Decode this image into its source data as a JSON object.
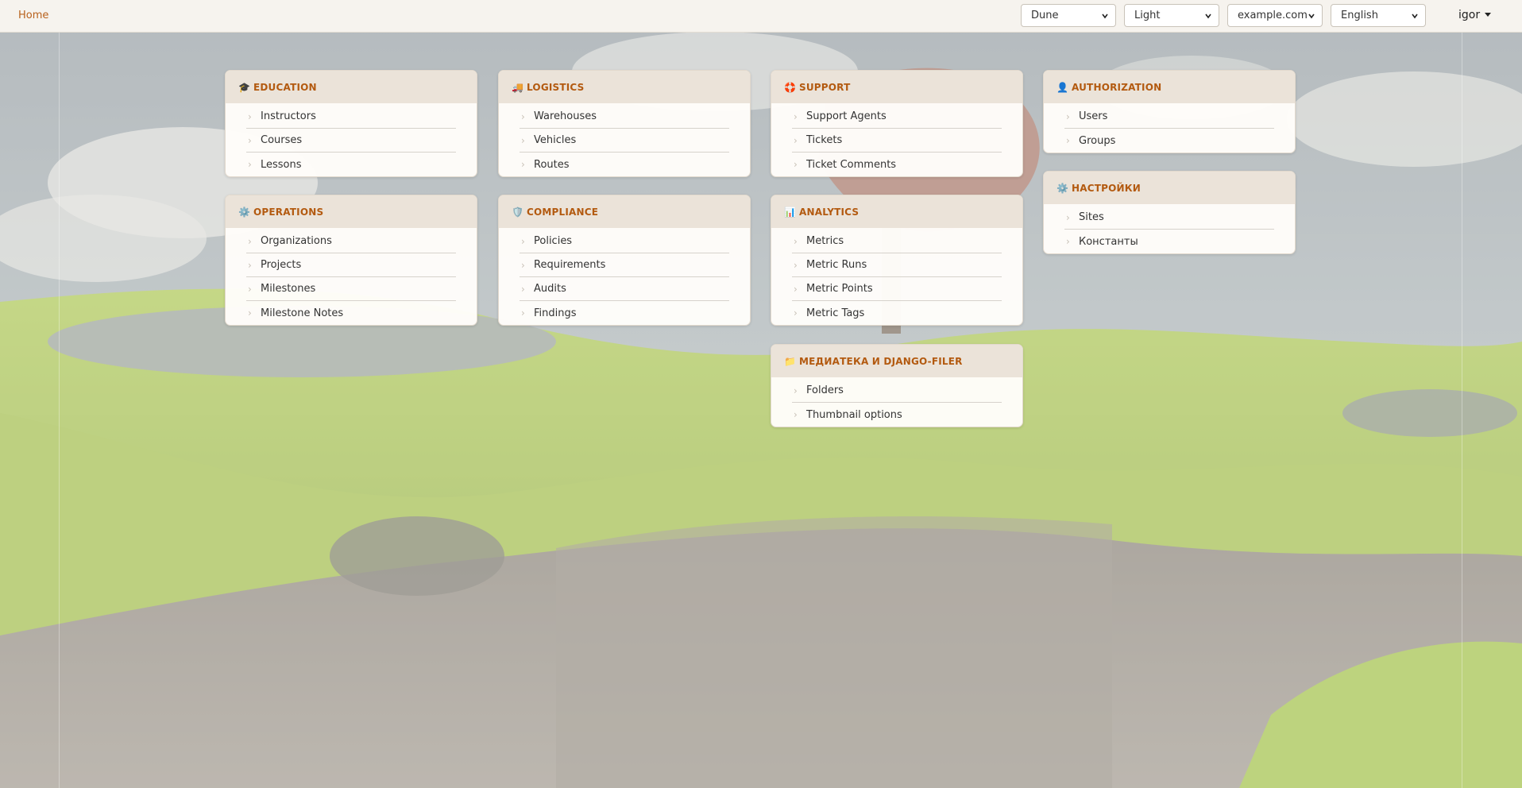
{
  "header": {
    "home_label": "Home",
    "selects": [
      {
        "value": "Dune"
      },
      {
        "value": "Light"
      },
      {
        "value": "example.com"
      },
      {
        "value": "English"
      }
    ],
    "user_label": "igor"
  },
  "modules": {
    "education": {
      "title": "EDUCATION",
      "icon": "graduation-cap-icon",
      "items": [
        {
          "label": "Instructors"
        },
        {
          "label": "Courses"
        },
        {
          "label": "Lessons"
        }
      ]
    },
    "logistics": {
      "title": "LOGISTICS",
      "icon": "truck-icon",
      "items": [
        {
          "label": "Warehouses"
        },
        {
          "label": "Vehicles"
        },
        {
          "label": "Routes"
        }
      ]
    },
    "support": {
      "title": "SUPPORT",
      "icon": "lifebuoy-icon",
      "items": [
        {
          "label": "Support Agents"
        },
        {
          "label": "Tickets"
        },
        {
          "label": "Ticket Comments"
        }
      ]
    },
    "authorization": {
      "title": "AUTHORIZATION",
      "icon": "user-icon",
      "items": [
        {
          "label": "Users"
        },
        {
          "label": "Groups"
        }
      ]
    },
    "operations": {
      "title": "OPERATIONS",
      "icon": "gear-icon",
      "items": [
        {
          "label": "Organizations"
        },
        {
          "label": "Projects"
        },
        {
          "label": "Milestones"
        },
        {
          "label": "Milestone Notes"
        }
      ]
    },
    "compliance": {
      "title": "COMPLIANCE",
      "icon": "shield-icon",
      "items": [
        {
          "label": "Policies"
        },
        {
          "label": "Requirements"
        },
        {
          "label": "Audits"
        },
        {
          "label": "Findings"
        }
      ]
    },
    "analytics": {
      "title": "ANALYTICS",
      "icon": "bar-chart-icon",
      "items": [
        {
          "label": "Metrics"
        },
        {
          "label": "Metric Runs"
        },
        {
          "label": "Metric Points"
        },
        {
          "label": "Metric Tags"
        }
      ]
    },
    "settings": {
      "title": "НАСТРОЙКИ",
      "icon": "gear-icon",
      "items": [
        {
          "label": "Sites"
        },
        {
          "label": "Константы"
        }
      ]
    },
    "media": {
      "title": "МЕДИАТЕКА И DJANGO-FILER",
      "icon": "folder-icon",
      "items": [
        {
          "label": "Folders"
        },
        {
          "label": "Thumbnail options"
        }
      ]
    }
  }
}
